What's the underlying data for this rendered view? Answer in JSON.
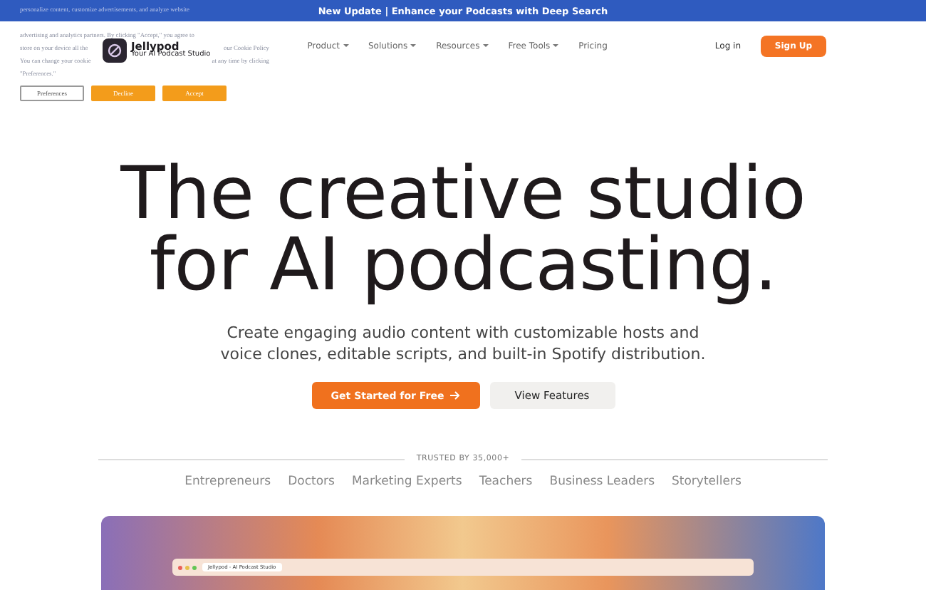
{
  "announcement": "New Update | Enhance your Podcasts with Deep Search",
  "cookie_banner": {
    "lines": [
      [
        "personalize content, customize advertisements, and analyze website"
      ],
      [
        "advertising and analytics partners. By clicking \"Accept,\" you agree to"
      ],
      [
        "store on your device all the",
        "our Cookie Policy"
      ],
      [
        "You can change your cookie",
        "at any time by clicking"
      ],
      [
        "\"Preferences.\""
      ]
    ],
    "buttons": [
      {
        "label": "Preferences",
        "kind": "outline"
      },
      {
        "label": "Decline",
        "kind": "filled"
      },
      {
        "label": "Accept",
        "kind": "filled"
      }
    ]
  },
  "logo": {
    "name": "Jellypod",
    "tagline": "Your AI Podcast Studio"
  },
  "nav": [
    {
      "label": "Product",
      "dropdown": true
    },
    {
      "label": "Solutions",
      "dropdown": true
    },
    {
      "label": "Resources",
      "dropdown": true
    },
    {
      "label": "Free Tools",
      "dropdown": true
    },
    {
      "label": "Pricing",
      "dropdown": false
    }
  ],
  "login": "Log in",
  "signup": "Sign Up",
  "hero": {
    "title_lines": [
      "The creative studio",
      "for AI podcasting."
    ],
    "subtitle_lines": [
      "Create engaging audio content with customizable hosts and",
      "voice clones, editable scripts, and built-in Spotify distribution."
    ],
    "primary": "Get Started for Free",
    "secondary": "View Features"
  },
  "trusted": {
    "label": "TRUSTED BY 35,000+",
    "audiences": [
      "Entrepreneurs",
      "Doctors",
      "Marketing Experts",
      "Teachers",
      "Business Leaders",
      "Storytellers"
    ]
  },
  "preview": {
    "tab_title": "Jellypod - AI Podcast Studio"
  }
}
